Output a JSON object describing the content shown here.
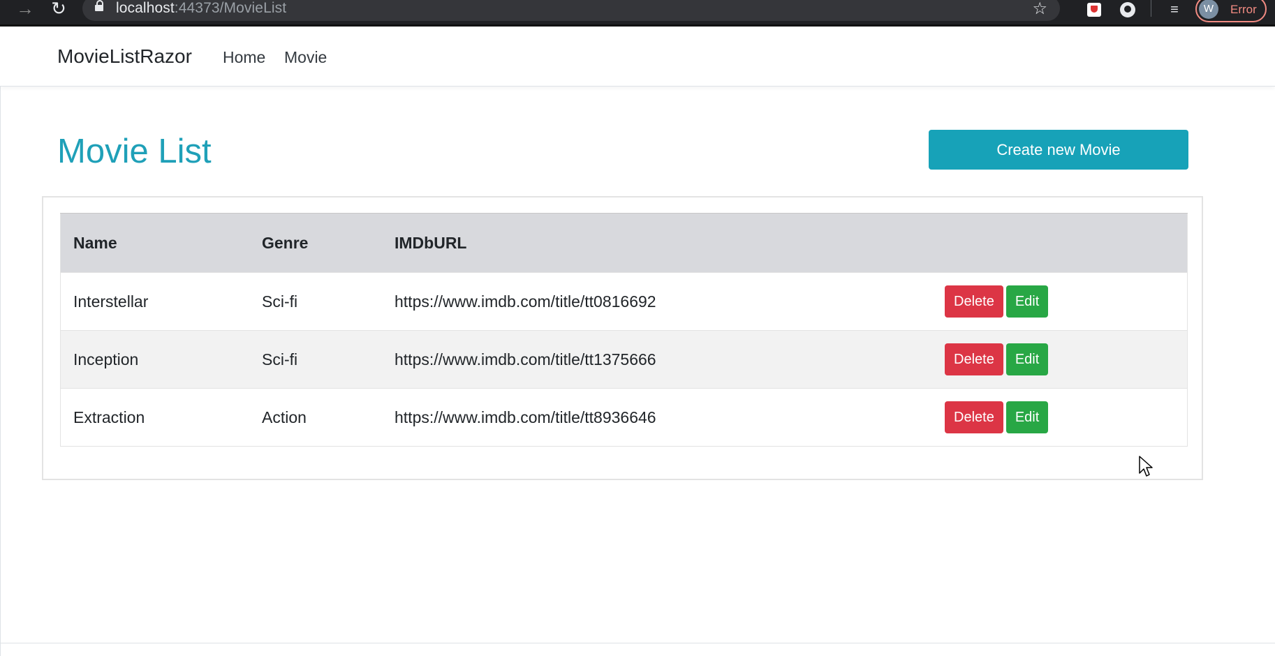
{
  "browser": {
    "back_glyph": "→",
    "reload_glyph": "↻",
    "url_host": "localhost",
    "url_rest": ":44373/MovieList",
    "star_glyph": "☆",
    "playlist_glyph": "≡",
    "profile_initial": "W",
    "profile_status": "Error"
  },
  "navbar": {
    "brand": "MovieListRazor",
    "links": [
      "Home",
      "Movie"
    ]
  },
  "page": {
    "title": "Movie List",
    "create_button": "Create new Movie"
  },
  "table": {
    "headers": [
      "Name",
      "Genre",
      "IMDbURL",
      ""
    ],
    "rows": [
      {
        "name": "Interstellar",
        "genre": "Sci-fi",
        "url": "https://www.imdb.com/title/tt0816692"
      },
      {
        "name": "Inception",
        "genre": "Sci-fi",
        "url": "https://www.imdb.com/title/tt1375666"
      },
      {
        "name": "Extraction",
        "genre": "Action",
        "url": "https://www.imdb.com/title/tt8936646"
      }
    ],
    "delete_label": "Delete",
    "edit_label": "Edit"
  },
  "colors": {
    "title": "#1fa0b8",
    "create_button": "#17a2b8",
    "delete_button": "#dc3545",
    "edit_button": "#28a745",
    "header_bg": "#d8d9dd"
  }
}
